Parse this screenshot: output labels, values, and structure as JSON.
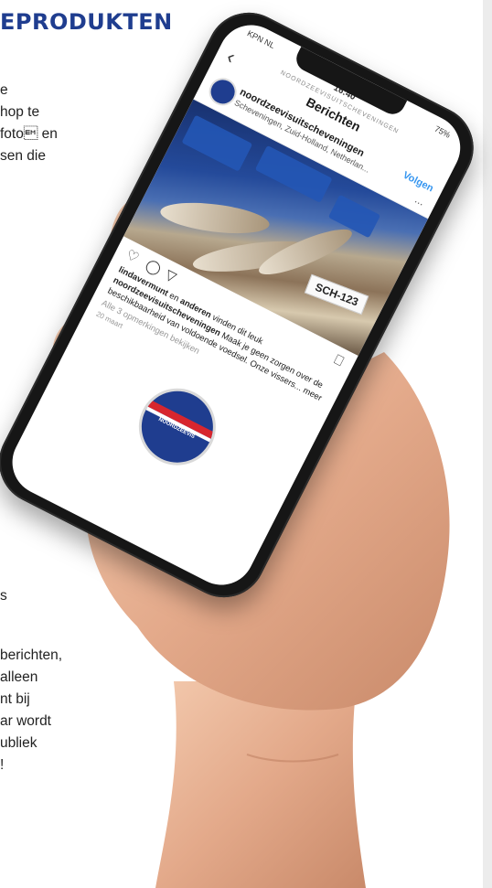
{
  "article": {
    "heading": "EPRODUKTEN",
    "top_lines": [
      "e",
      "hop te",
      "foto\u0019 en",
      "sen die"
    ],
    "lone_line": "s",
    "bottom_lines": [
      "berichten,",
      "alleen",
      "nt bij",
      "ar wordt",
      "ubliek",
      "!"
    ]
  },
  "phone": {
    "status": {
      "carrier": "KPN NL",
      "time": "16:40",
      "battery": "75%"
    },
    "nav": {
      "back": "‹",
      "account": "NOORDZEEVISUITSCHEVENINGEN",
      "title": "Berichten"
    },
    "post": {
      "account_name": "noordzeevisuitscheveningen",
      "location": "Scheveningen, Zuid-Holland, Netherlan...",
      "follow_label": "Volgen",
      "more_label": "...",
      "photo_label": "SCH-123",
      "likes_prefix": "lindavermunt",
      "likes_mid": " en ",
      "likes_others": "anderen",
      "likes_suffix": " vinden dit leuk",
      "caption_account": "noordzeevisuitscheveningen",
      "caption_text": " Maak je geen zorgen over de beschikbaarheid van voldoende voedsel. Onze vissers... meer",
      "comments": "Alle 3 opmerkingen bekijken",
      "date": "20 maart"
    },
    "logo_text": "NOORDZEEVIS"
  },
  "colors": {
    "brand_blue": "#1f3d8f",
    "brand_red": "#d7262e",
    "link_blue": "#3897f0"
  },
  "icons": [
    "chevron-left-icon",
    "heart-icon",
    "comment-icon",
    "share-icon",
    "bookmark-icon"
  ]
}
